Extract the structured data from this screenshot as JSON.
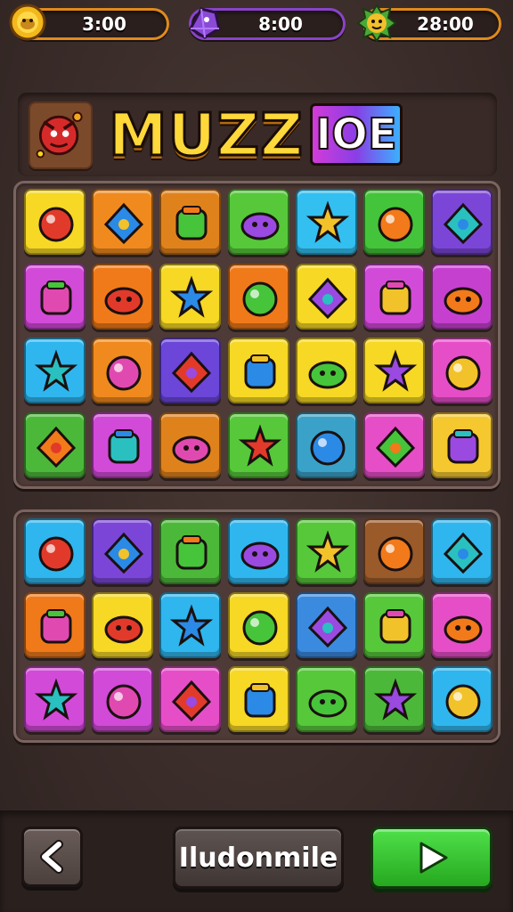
{
  "currencies": [
    {
      "icon": "gold-coin-icon",
      "value": "3:00"
    },
    {
      "icon": "purple-gem-icon",
      "value": "8:00"
    },
    {
      "icon": "green-monster-icon",
      "value": "28:00"
    }
  ],
  "title": {
    "main": "MUZZ",
    "suffix": "IOE",
    "badge_icon": "red-monster-emblem-icon"
  },
  "board_top": [
    {
      "color": "#f6d825",
      "icon": "triangle-ruler-icon"
    },
    {
      "color": "#f08a1e",
      "icon": "orange-fruit-icon"
    },
    {
      "color": "#e0821c",
      "icon": "green-tube-icon"
    },
    {
      "color": "#56c83a",
      "icon": "leaf-umbrella-icon"
    },
    {
      "color": "#33bff0",
      "icon": "wrench-icon"
    },
    {
      "color": "#44c43a",
      "icon": "red-yellow-ball-icon"
    },
    {
      "color": "#7b46d8",
      "icon": "sun-gear-icon"
    },
    {
      "color": "#d24ad8",
      "icon": "green-tree-icon"
    },
    {
      "color": "#f07a1a",
      "icon": "peach-icon"
    },
    {
      "color": "#f6d825",
      "icon": "blue-drop-icon"
    },
    {
      "color": "#f07a1a",
      "icon": "red-creature-icon"
    },
    {
      "color": "#f6d825",
      "icon": "cat-face-icon"
    },
    {
      "color": "#d24ad8",
      "icon": "snowflake-icon"
    },
    {
      "color": "#c640d0",
      "icon": "twin-orbs-icon"
    },
    {
      "color": "#2fb6ee",
      "icon": "red-lips-icon"
    },
    {
      "color": "#f08a1e",
      "icon": "kite-icon"
    },
    {
      "color": "#6b46d8",
      "icon": "spiral-shell-icon"
    },
    {
      "color": "#f6d825",
      "icon": "red-heart-fruit-icon"
    },
    {
      "color": "#f6d825",
      "icon": "mushroom-creature-icon"
    },
    {
      "color": "#f6d825",
      "icon": "blue-fish-icon"
    },
    {
      "color": "#e64ec8",
      "icon": "green-jar-icon"
    },
    {
      "color": "#4cb83a",
      "icon": "pink-flower-icon"
    },
    {
      "color": "#d24ad8",
      "icon": "layered-cone-icon"
    },
    {
      "color": "#e0821c",
      "icon": "bread-loaf-icon"
    },
    {
      "color": "#56c83a",
      "icon": "orange-pepper-icon"
    },
    {
      "color": "#3aa2c8",
      "icon": "purple-rings-icon"
    },
    {
      "color": "#e64ec8",
      "icon": "orange-ball-icon"
    },
    {
      "color": "#f6c830",
      "icon": "palm-tree-icon"
    }
  ],
  "board_bottom": [
    {
      "color": "#2fb6ee",
      "icon": "green-virus-icon"
    },
    {
      "color": "#7b46d8",
      "icon": "target-swirl-icon"
    },
    {
      "color": "#4cb83a",
      "icon": "yellow-bottle-icon"
    },
    {
      "color": "#2fb6ee",
      "icon": "purple-potion-icon"
    },
    {
      "color": "#56c83a",
      "icon": "book-stack-icon"
    },
    {
      "color": "#9a5a2a",
      "icon": "red-house-icon"
    },
    {
      "color": "#2fb6ee",
      "icon": "red-cat-icon"
    },
    {
      "color": "#f07a1a",
      "icon": "red-bomb-icon"
    },
    {
      "color": "#f6d825",
      "icon": "green-ball-icon"
    },
    {
      "color": "#2fb6ee",
      "icon": "stick-icon"
    },
    {
      "color": "#f6d825",
      "icon": "red-number-nine-icon"
    },
    {
      "color": "#3a8ae0",
      "icon": "purple-planet-icon"
    },
    {
      "color": "#56c83a",
      "icon": "yellow-snail-icon"
    },
    {
      "color": "#e64ec8",
      "icon": "teal-mirror-icon"
    },
    {
      "color": "#d24ad8",
      "icon": "blue-candy-icon"
    },
    {
      "color": "#d24ad8",
      "icon": "purple-gear-icon"
    },
    {
      "color": "#e64ec8",
      "icon": "teal-melon-icon"
    },
    {
      "color": "#f6d825",
      "icon": "red-heart-icon"
    },
    {
      "color": "#56c83a",
      "icon": "blue-leaf-icon"
    },
    {
      "color": "#4cb83a",
      "icon": "banana-icon"
    },
    {
      "color": "#2fb6ee",
      "icon": "orange-machine-icon"
    }
  ],
  "nav": {
    "back_icon": "chevron-left-icon",
    "middle_label": "Iludonmile",
    "play_icon": "play-triangle-icon"
  }
}
